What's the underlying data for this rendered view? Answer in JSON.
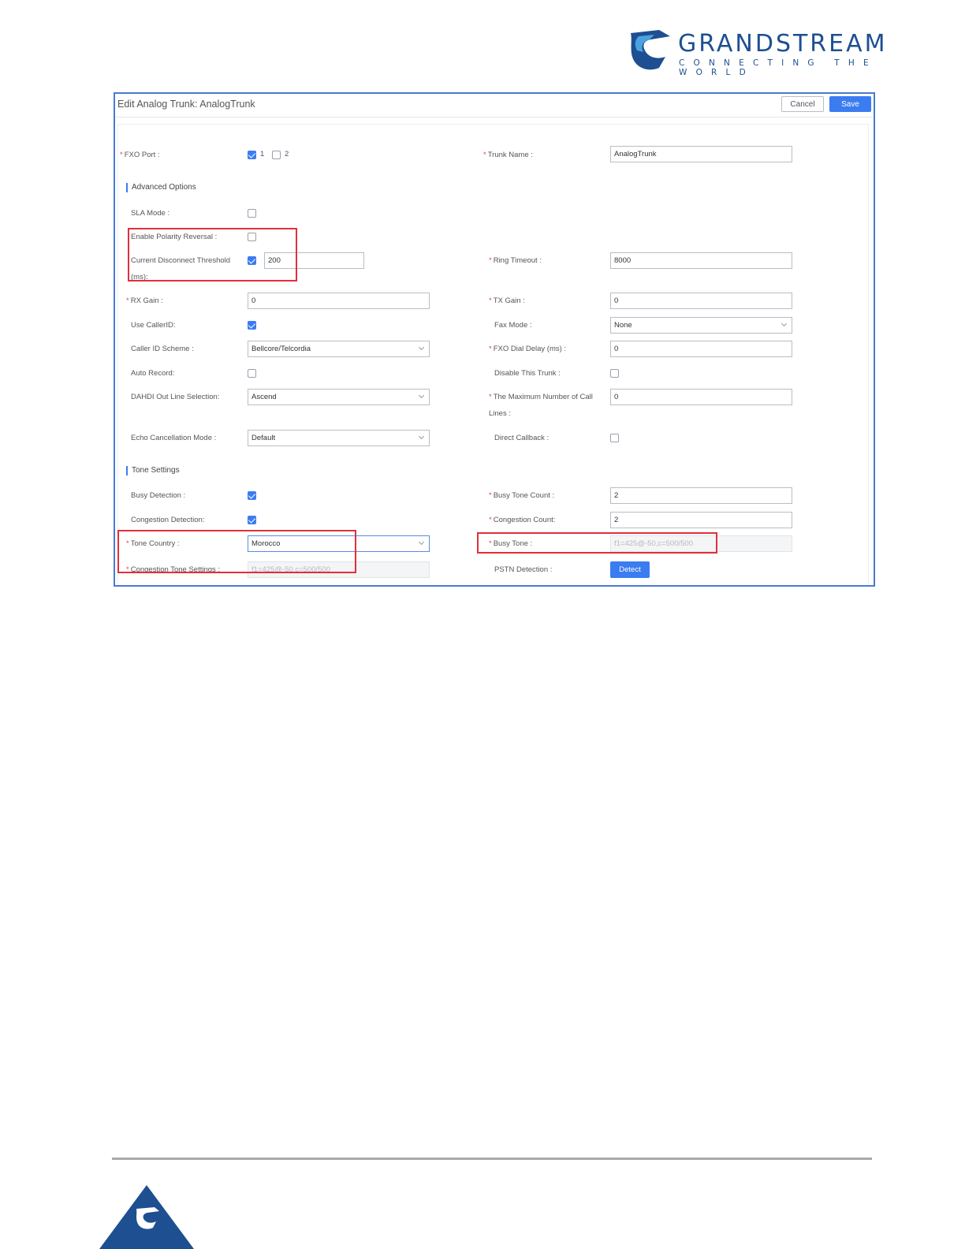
{
  "brand": {
    "name": "GRANDSTREAM",
    "tagline": "CONNECTING THE WORLD",
    "color": "#1d4f91"
  },
  "dialog": {
    "title": "Edit Analog Trunk: AnalogTrunk",
    "cancel_label": "Cancel",
    "save_label": "Save",
    "accent": "#3c7cf1"
  },
  "form": {
    "fxo_port": {
      "label": "FXO Port :",
      "required": "*",
      "options": [
        {
          "label": "1",
          "checked": true
        },
        {
          "label": "2",
          "checked": false
        }
      ]
    },
    "trunk_name": {
      "label": "Trunk Name :",
      "required": "*",
      "value": "AnalogTrunk"
    },
    "advanced_options": {
      "title": "Advanced Options"
    },
    "sla_mode": {
      "label": "SLA Mode :",
      "checked": false
    },
    "polarity_reversal": {
      "label": "Enable Polarity Reversal :",
      "checked": false
    },
    "disconnect_threshold": {
      "label": "Current Disconnect Threshold (ms):",
      "checked": true,
      "value": "200"
    },
    "ring_timeout": {
      "label": "Ring Timeout :",
      "required": "*",
      "value": "8000"
    },
    "rx_gain": {
      "label": "RX Gain :",
      "required": "*",
      "value": "0"
    },
    "tx_gain": {
      "label": "TX Gain :",
      "required": "*",
      "value": "0"
    },
    "use_callerid": {
      "label": "Use CallerID:",
      "checked": true
    },
    "fax_mode": {
      "label": "Fax Mode :",
      "value": "None"
    },
    "callerid_scheme": {
      "label": "Caller ID Scheme :",
      "value": "Bellcore/Telcordia"
    },
    "fxo_dial_delay": {
      "label": "FXO Dial Delay (ms) :",
      "required": "*",
      "value": "0"
    },
    "auto_record": {
      "label": "Auto Record:",
      "checked": false
    },
    "disable_trunk": {
      "label": "Disable This Trunk :",
      "checked": false
    },
    "dahdi_out_line": {
      "label": "DAHDI Out Line Selection:",
      "value": "Ascend"
    },
    "max_call_lines": {
      "label": "The Maximum Number of Call Lines :",
      "required": "*",
      "value": "0"
    },
    "echo_cancellation": {
      "label": "Echo Cancellation Mode :",
      "value": "Default"
    },
    "direct_callback": {
      "label": "Direct Callback :",
      "checked": false
    },
    "tone_settings": {
      "title": "Tone Settings"
    },
    "busy_detection": {
      "label": "Busy Detection :",
      "checked": true
    },
    "busy_tone_count": {
      "label": "Busy Tone Count :",
      "required": "*",
      "value": "2"
    },
    "congestion_detection": {
      "label": "Congestion Detection:",
      "checked": true
    },
    "congestion_count": {
      "label": "Congestion Count:",
      "required": "*",
      "value": "2"
    },
    "tone_country": {
      "label": "Tone Country :",
      "required": "*",
      "value": "Morocco"
    },
    "busy_tone": {
      "label": "Busy Tone :",
      "required": "*",
      "value": "f1=425@-50,c=500/500"
    },
    "congestion_tone": {
      "label": "Congestion Tone Settings :",
      "required": "*",
      "value": "f1=425@-50,c=500/500"
    },
    "pstn_detection": {
      "label": "PSTN Detection :",
      "button": "Detect"
    }
  },
  "highlight_color": "#e0303a"
}
